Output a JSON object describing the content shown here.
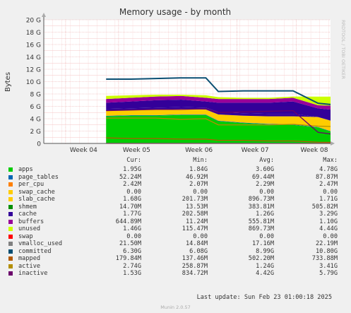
{
  "chart_data": {
    "type": "area",
    "title": "Memory usage - by month",
    "ylabel": "Bytes",
    "side_label": "RRDTOOL / TOBI OETIKER",
    "ylim": [
      0,
      20
    ],
    "y_unit": "G",
    "y_ticks": [
      "0",
      "2 G",
      "4 G",
      "6 G",
      "8 G",
      "10 G",
      "12 G",
      "14 G",
      "16 G",
      "18 G",
      "20 G"
    ],
    "x_ticks": [
      "Week 04",
      "Week 05",
      "Week 06",
      "Week 07",
      "Week 08"
    ],
    "grid": true,
    "x": [
      0.0,
      1.0,
      1.4,
      1.8,
      2.2,
      2.6,
      2.8,
      3.2,
      3.6,
      4.0,
      4.4,
      4.6
    ],
    "series": [
      {
        "name": "apps",
        "color": "#00cc00",
        "values": [
          null,
          4.4,
          4.5,
          4.5,
          4.6,
          4.6,
          3.6,
          3.3,
          3.1,
          3.0,
          2.6,
          1.95
        ]
      },
      {
        "name": "page_tables",
        "color": "#0066b3",
        "values": [
          null,
          0.07,
          0.07,
          0.07,
          0.07,
          0.07,
          0.07,
          0.07,
          0.07,
          0.07,
          0.06,
          0.05
        ]
      },
      {
        "name": "per_cpu",
        "color": "#ff8000",
        "values": [
          null,
          0.01,
          0.01,
          0.01,
          0.01,
          0.01,
          0.01,
          0.01,
          0.01,
          0.01,
          0.01,
          0.01
        ]
      },
      {
        "name": "swap_cache",
        "color": "#ffcc00",
        "values": [
          null,
          0,
          0,
          0,
          0,
          0,
          0,
          0,
          0,
          0,
          0,
          0
        ]
      },
      {
        "name": "slab_cache",
        "color": "#ffcc00",
        "values": [
          null,
          0.8,
          0.8,
          0.9,
          0.9,
          0.8,
          1.0,
          1.1,
          1.2,
          1.3,
          1.6,
          1.68
        ]
      },
      {
        "name": "shmem",
        "color": "#330099",
        "values": [
          null,
          0.3,
          0.3,
          0.3,
          0.3,
          0.3,
          0.4,
          0.4,
          0.4,
          0.4,
          0.0,
          0.01
        ]
      },
      {
        "name": "cache",
        "color": "#330099",
        "values": [
          null,
          1.0,
          1.1,
          1.2,
          1.2,
          1.0,
          1.5,
          1.7,
          1.8,
          2.0,
          1.4,
          1.77
        ]
      },
      {
        "name": "buffers",
        "color": "#990099",
        "values": [
          null,
          0.6,
          0.6,
          0.6,
          0.6,
          0.6,
          0.6,
          0.6,
          0.6,
          0.6,
          0.5,
          0.64
        ]
      },
      {
        "name": "unused",
        "color": "#ccff00",
        "values": [
          null,
          0.5,
          0.4,
          0.3,
          0.2,
          0.4,
          0.3,
          0.2,
          0.2,
          0.2,
          1.4,
          1.46
        ]
      }
    ],
    "lines": [
      {
        "name": "swap",
        "color": "#ff0000",
        "values": [
          null,
          0,
          0,
          0,
          0,
          0,
          0,
          0,
          0,
          0,
          0,
          0
        ]
      },
      {
        "name": "vmalloc_used",
        "color": "#808080",
        "values": [
          null,
          0.02,
          0.02,
          0.02,
          0.02,
          0.02,
          0.02,
          0.02,
          0.02,
          0.02,
          0.02,
          0.02
        ]
      },
      {
        "name": "committed",
        "color": "#0b4f73",
        "values": [
          null,
          10.4,
          10.4,
          10.5,
          10.6,
          10.6,
          8.4,
          8.5,
          8.5,
          8.5,
          6.5,
          6.3
        ]
      },
      {
        "name": "mapped",
        "color": "#b35a00",
        "values": [
          null,
          0.9,
          0.8,
          0.8,
          0.7,
          0.7,
          0.5,
          0.5,
          0.4,
          0.4,
          0.2,
          0.18
        ]
      },
      {
        "name": "active",
        "color": "#b38f00",
        "values": [
          null,
          4.1,
          4.1,
          4.1,
          3.9,
          4.0,
          3.0,
          3.0,
          3.0,
          3.1,
          2.8,
          2.74
        ]
      },
      {
        "name": "inactive",
        "color": "#6b006b",
        "values": [
          null,
          5.3,
          5.4,
          5.5,
          5.5,
          5.6,
          5.0,
          5.1,
          5.2,
          5.3,
          1.8,
          1.53
        ]
      }
    ]
  },
  "legend": {
    "headers": {
      "cur": "Cur:",
      "min": "Min:",
      "avg": "Avg:",
      "max": "Max:"
    },
    "rows": [
      {
        "name": "apps",
        "color": "#00cc00",
        "cur": "1.95G",
        "min": "1.84G",
        "avg": "3.60G",
        "max": "4.78G"
      },
      {
        "name": "page_tables",
        "color": "#0066b3",
        "cur": "52.24M",
        "min": "46.92M",
        "avg": "69.44M",
        "max": "87.87M"
      },
      {
        "name": "per_cpu",
        "color": "#ff8000",
        "cur": "2.42M",
        "min": "2.07M",
        "avg": "2.29M",
        "max": "2.47M"
      },
      {
        "name": "swap_cache",
        "color": "#ffcc00",
        "cur": "0.00",
        "min": "0.00",
        "avg": "0.00",
        "max": "0.00"
      },
      {
        "name": "slab_cache",
        "color": "#ffcc00",
        "cur": "1.68G",
        "min": "201.73M",
        "avg": "896.73M",
        "max": "1.71G"
      },
      {
        "name": "shmem",
        "color": "#008f00",
        "cur": "14.70M",
        "min": "13.53M",
        "avg": "383.81M",
        "max": "505.82M"
      },
      {
        "name": "cache",
        "color": "#330099",
        "cur": "1.77G",
        "min": "202.58M",
        "avg": "1.26G",
        "max": "3.29G"
      },
      {
        "name": "buffers",
        "color": "#990099",
        "cur": "644.89M",
        "min": "11.24M",
        "avg": "555.81M",
        "max": "1.10G"
      },
      {
        "name": "unused",
        "color": "#ccff00",
        "cur": "1.46G",
        "min": "115.47M",
        "avg": "869.73M",
        "max": "4.44G"
      },
      {
        "name": "swap",
        "color": "#ff0000",
        "cur": "0.00",
        "min": "0.00",
        "avg": "0.00",
        "max": "0.00"
      },
      {
        "name": "vmalloc_used",
        "color": "#808080",
        "cur": "21.50M",
        "min": "14.84M",
        "avg": "17.16M",
        "max": "22.19M"
      },
      {
        "name": "committed",
        "color": "#004d71",
        "cur": "6.30G",
        "min": "6.08G",
        "avg": "8.99G",
        "max": "10.80G"
      },
      {
        "name": "mapped",
        "color": "#b35a00",
        "cur": "179.84M",
        "min": "137.46M",
        "avg": "502.20M",
        "max": "733.88M"
      },
      {
        "name": "active",
        "color": "#b38f00",
        "cur": "2.74G",
        "min": "258.87M",
        "avg": "1.24G",
        "max": "3.41G"
      },
      {
        "name": "inactive",
        "color": "#6b006b",
        "cur": "1.53G",
        "min": "834.72M",
        "avg": "4.42G",
        "max": "5.79G"
      }
    ],
    "last_update": "Last update:  Sun Feb 23 01:00:18 2025",
    "footer": "Munin 2.0.57"
  }
}
